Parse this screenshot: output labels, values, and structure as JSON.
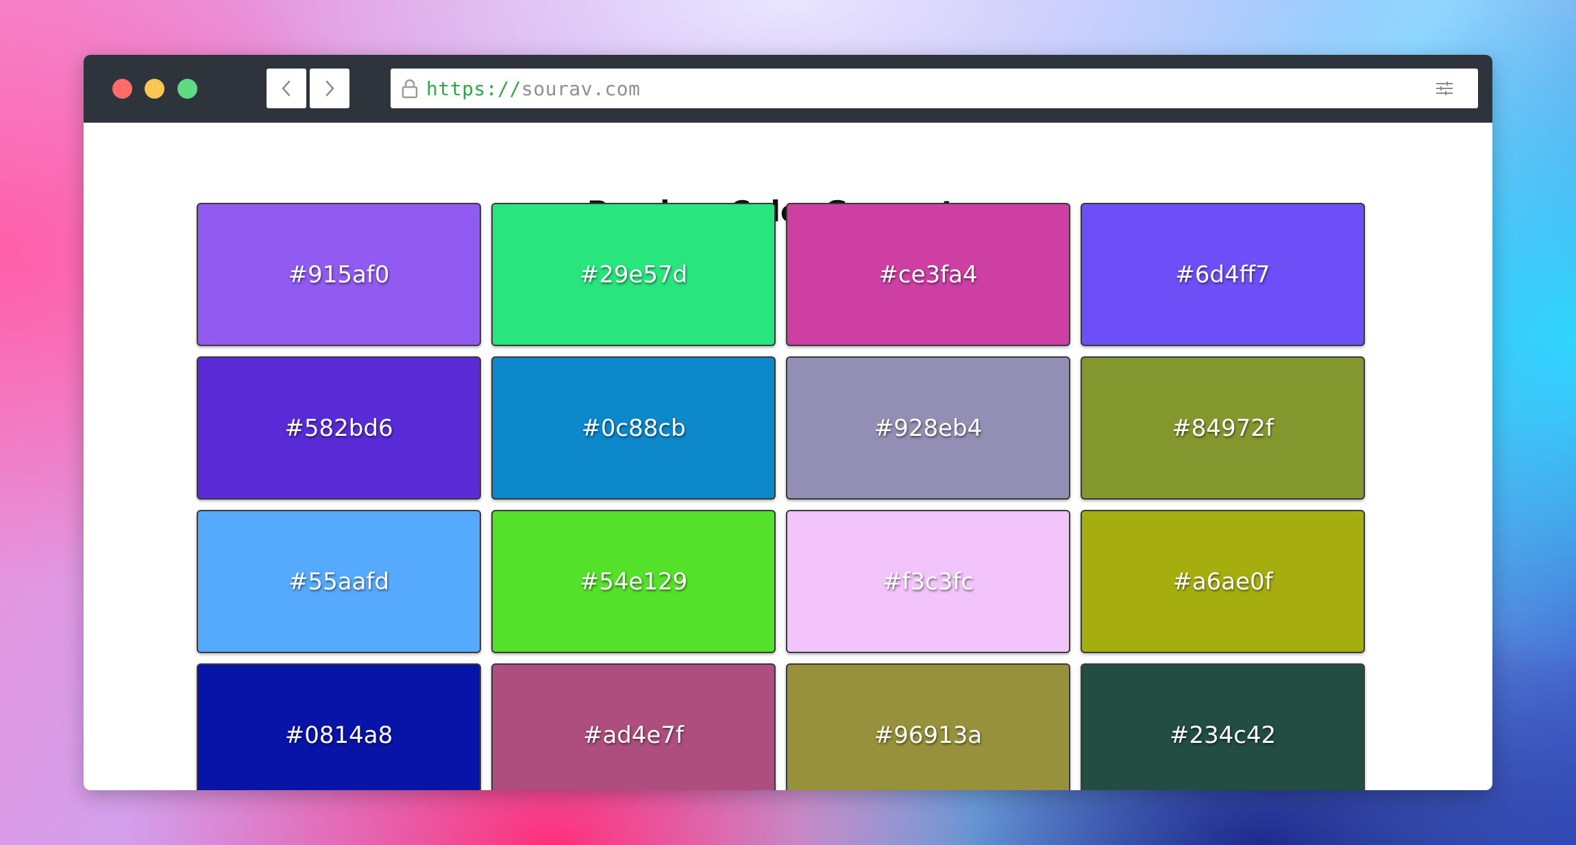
{
  "browser": {
    "url_scheme": "https://",
    "url_host": "sourav.com",
    "traffic_lights": {
      "red": "#fd6c67",
      "yellow": "#fdc552",
      "green": "#5fdc83"
    },
    "icons": {
      "back": "chevron-left-icon",
      "forward": "chevron-right-icon",
      "lock": "lock-icon",
      "settings": "sliders-icon"
    }
  },
  "page": {
    "title": "Random Color Generator",
    "colors": [
      "#915af0",
      "#29e57d",
      "#ce3fa4",
      "#6d4ff7",
      "#582bd6",
      "#0c88cb",
      "#928eb4",
      "#84972f",
      "#55aafd",
      "#54e129",
      "#f3c3fc",
      "#a6ae0f",
      "#0814a8",
      "#ad4e7f",
      "#96913a",
      "#234c42"
    ]
  }
}
